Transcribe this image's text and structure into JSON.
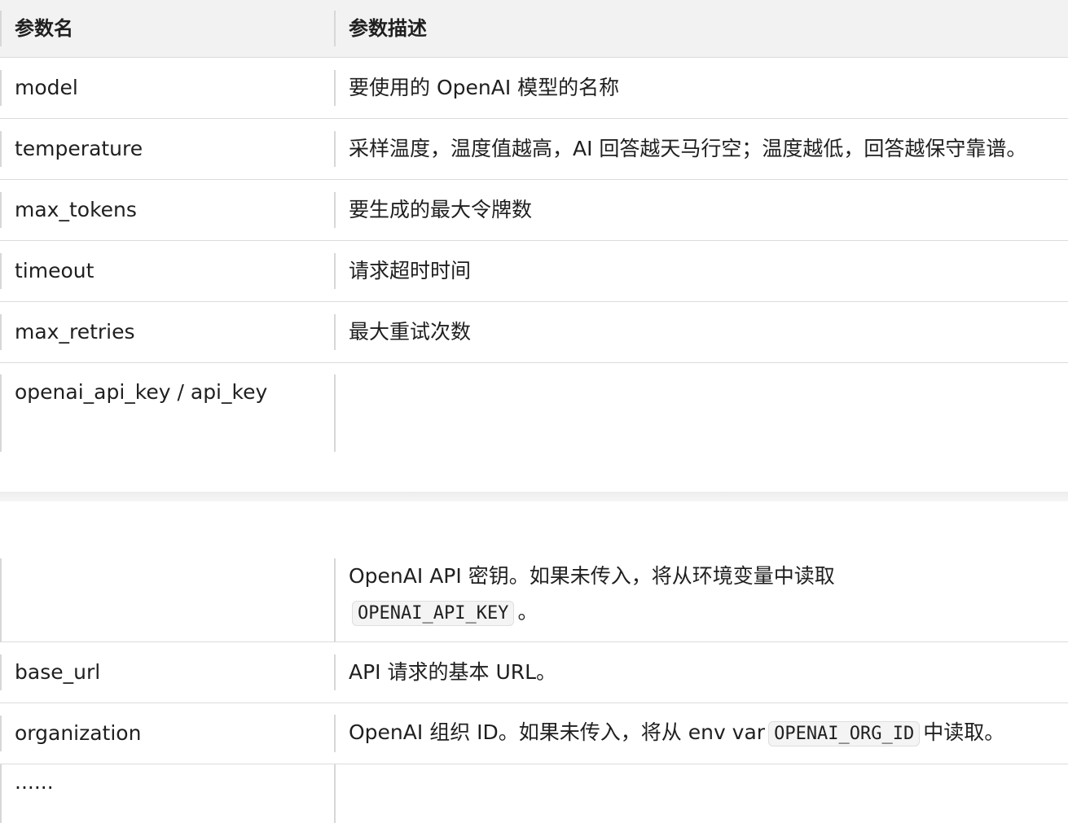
{
  "header": {
    "col1": "参数名",
    "col2": "参数描述"
  },
  "rows_top": [
    {
      "name": "model",
      "desc": "要使用的 OpenAI 模型的名称"
    },
    {
      "name": "temperature",
      "desc": "采样温度，温度值越高，AI 回答越天马行空；温度越低，回答越保守靠谱。"
    },
    {
      "name": "max_tokens",
      "desc": "要生成的最大令牌数"
    },
    {
      "name": "timeout",
      "desc": "请求超时时间"
    },
    {
      "name": "max_retries",
      "desc": "最大重试次数"
    },
    {
      "name": "openai_api_key / api_key",
      "desc": ""
    }
  ],
  "api_key_desc": {
    "line1": "OpenAI API 密钥。如果未传入，将从环境变量中读取",
    "code": "OPENAI_API_KEY",
    "suffix": "。"
  },
  "rows_bottom": [
    {
      "name": "base_url",
      "desc": "API 请求的基本 URL。"
    }
  ],
  "organization": {
    "name": "organization",
    "prefix": "OpenAI 组织 ID。如果未传入，将从 env var",
    "code": "OPENAI_ORG_ID",
    "suffix": "中读取。"
  },
  "ellipsis_row": {
    "name": "......",
    "desc": ""
  }
}
